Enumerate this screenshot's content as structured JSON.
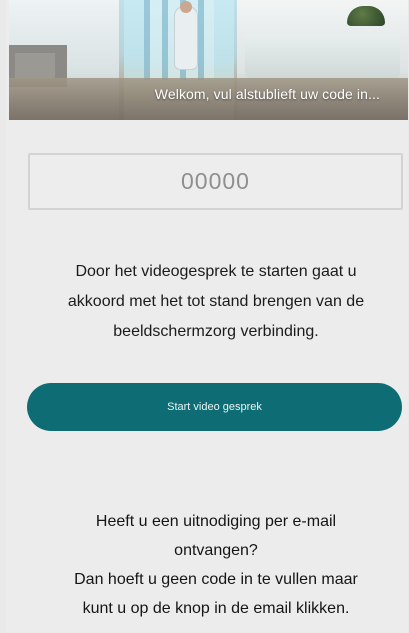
{
  "hero": {
    "caption": "Welkom, vul alstublieft uw code in..."
  },
  "code_field": {
    "placeholder": "00000"
  },
  "consent": {
    "lines": [
      "Door het videogesprek te starten gaat u",
      "akkoord met het tot stand brengen van de",
      "beeldschermzorg verbinding."
    ]
  },
  "start_button": {
    "label": "Start video gesprek"
  },
  "email_info": {
    "lines": [
      "Heeft u een uitnodiging per e-mail",
      "ontvangen?",
      "Dan hoeft u geen code in te vullen maar",
      "kunt u op de knop in de email klikken."
    ]
  },
  "colors": {
    "accent": "#0e6d74",
    "background": "#ececec",
    "input_border": "#d3d3d3"
  }
}
